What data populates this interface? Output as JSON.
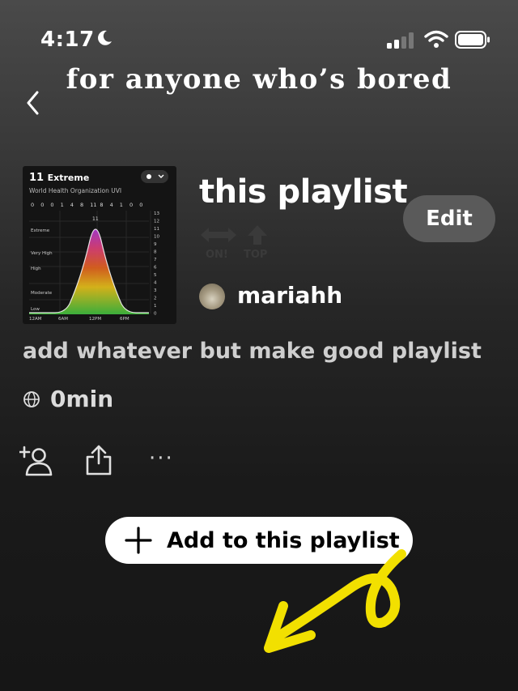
{
  "status_bar": {
    "time": "4:17"
  },
  "caption": "for anyone who’s bored",
  "cover": {
    "uv_value": "11",
    "uv_label": "Extreme",
    "org_label": "World Health Organization UVI",
    "hourly_values": [
      "0",
      "0",
      "0",
      "1",
      "4",
      "8",
      "11",
      "8",
      "4",
      "1",
      "0",
      "0"
    ],
    "peak_label": "11",
    "levels": [
      "Extreme",
      "Very High",
      "High",
      "Moderate",
      "Low"
    ],
    "time_labels": [
      "12AM",
      "6AM",
      "12PM",
      "6PM"
    ],
    "scale": [
      "13",
      "12",
      "11",
      "10",
      "9",
      "8",
      "7",
      "6",
      "5",
      "4",
      "3",
      "2",
      "1",
      "0"
    ]
  },
  "playlist": {
    "title": "this playlist",
    "edit_label": "Edit",
    "ghost_labels": [
      "ON!",
      "TOP"
    ],
    "owner": "mariahh",
    "description": "add whatever but make good playlist",
    "duration": "0min"
  },
  "actions": {
    "more_label": "···",
    "add_label": "Add to this playlist"
  },
  "colors": {
    "background": "#1a1a1a",
    "edit_button": "#5a5a5a",
    "doodle": "#f2e000"
  }
}
